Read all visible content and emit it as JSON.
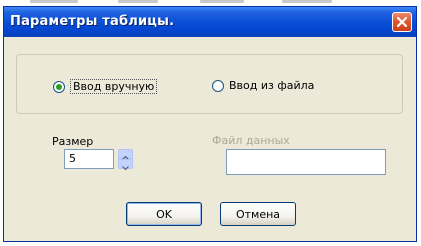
{
  "window": {
    "title": "Параметры таблицы."
  },
  "input_mode": {
    "manual_label": "Ввод вручную",
    "from_file_label": "Ввод из файла",
    "selected": "manual"
  },
  "size": {
    "label": "Размер",
    "value": "5"
  },
  "data_file": {
    "label": "Файл данных",
    "value": ""
  },
  "buttons": {
    "ok_label": "OK",
    "cancel_label": "Отмена"
  },
  "colors": {
    "titlebar": "#0a4fd6",
    "dialog_bg": "#ece9d8",
    "close_button": "#e05a30",
    "radio_selected": "#21a121"
  },
  "icons": {
    "close": "close-icon",
    "spin_up": "chevron-up-icon",
    "spin_down": "chevron-down-icon"
  }
}
